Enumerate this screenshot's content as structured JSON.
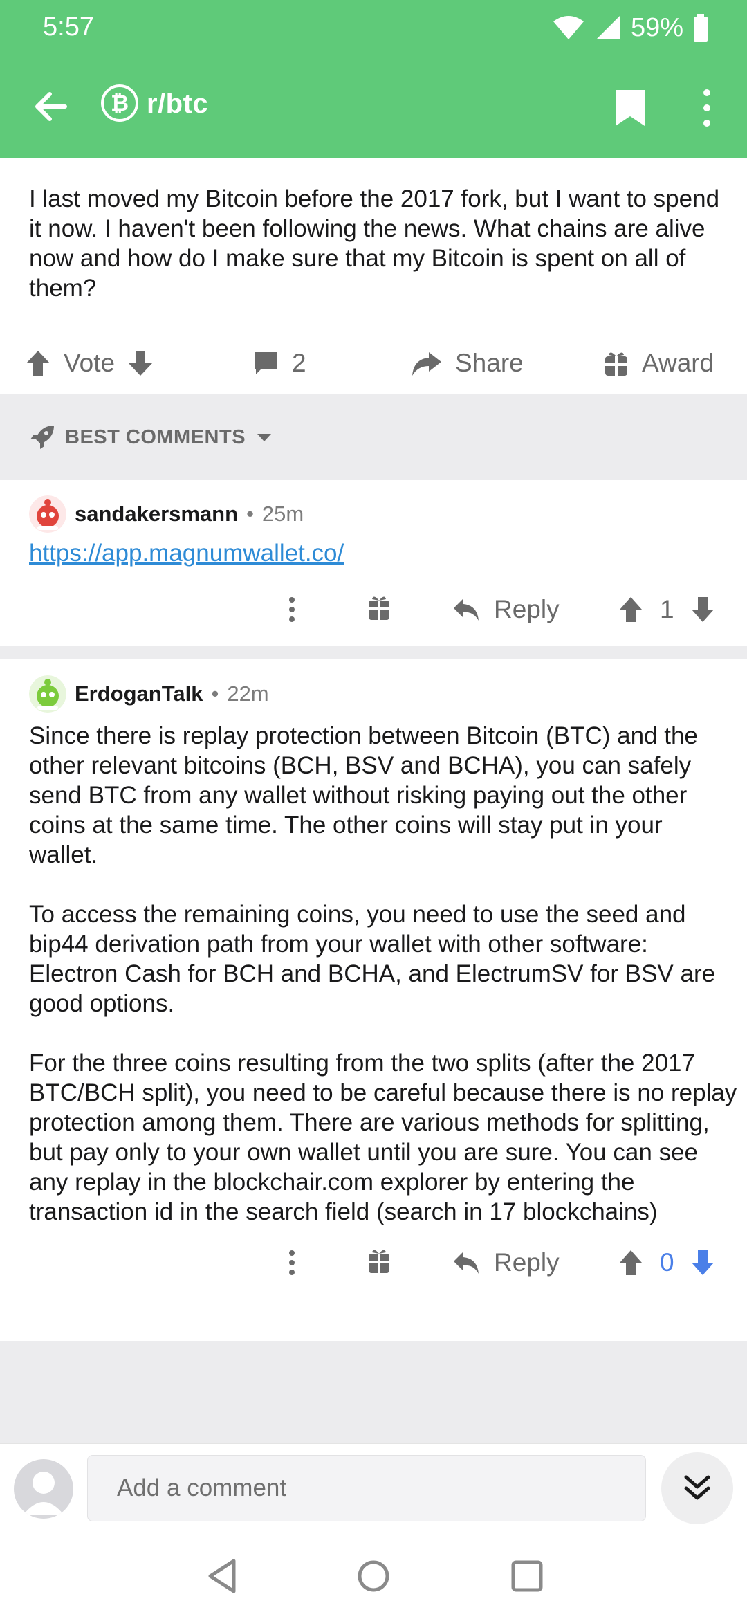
{
  "status": {
    "time": "5:57",
    "battery": "59%"
  },
  "appbar": {
    "subreddit": "r/btc",
    "sub_icon": "bitcoin-icon"
  },
  "post": {
    "body": "I last moved my Bitcoin before the 2017 fork, but I want to spend it now. I haven't been following the news. What chains are alive now and how do I make sure that my Bitcoin is spent on all of them?",
    "actions": {
      "vote_label": "Vote",
      "comment_count": "2",
      "share_label": "Share",
      "award_label": "Award"
    }
  },
  "sort": {
    "label": "BEST COMMENTS"
  },
  "comments": [
    {
      "author": "sandakersmann",
      "age": "25m",
      "link": "https://app.magnumwallet.co/",
      "reply_label": "Reply",
      "score": "1"
    },
    {
      "author": "ErdoganTalk",
      "age": "22m",
      "paragraphs": [
        "Since there is replay protection between Bitcoin (BTC) and the other relevant bitcoins (BCH, BSV and BCHA), you can safely send BTC from any wallet without risking paying out the other coins at the same time. The other coins will stay put in your wallet.",
        "To access the remaining coins, you need to use the seed and bip44 derivation path from your wallet with other software: Electron Cash for BCH and BCHA, and ElectrumSV for BSV are good options.",
        "For the three coins resulting from the two splits (after the 2017 BTC/BCH split), you need to be careful because there is no replay protection among them. There are various methods for splitting, but pay only to your own wallet until you are sure. You can see any replay in the blockchair.com explorer by entering the transaction id in the search field (search in 17 blockchains)"
      ],
      "reply_label": "Reply",
      "score": "0"
    }
  ],
  "composer": {
    "placeholder": "Add a comment"
  },
  "colors": {
    "header": "#5fca79",
    "upvoted_blue": "#4a7fe8",
    "link": "#2e8bd6"
  }
}
